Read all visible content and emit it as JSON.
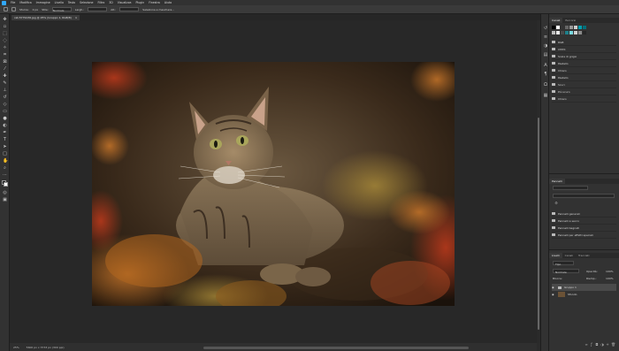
{
  "menubar": {
    "items": [
      "File",
      "Modifica",
      "Immagine",
      "Livello",
      "Testo",
      "Selezione",
      "Filtro",
      "3D",
      "Visualizza",
      "Plugin",
      "Finestra",
      "Aiuto"
    ]
  },
  "optionsbar": {
    "sfumatura_label": "Sfuma:",
    "sfumatura_value": "0 px",
    "stile_label": "Stile:",
    "stile_value": "Normale",
    "larghezza_label": "Largh.:",
    "altezza_label": "Alt.:",
    "seleziona_label": "Seleziona e maschera..."
  },
  "document": {
    "tab_title": "cat-5779136.jpg @ 25% (Gruppo 1, RGB/8)",
    "close_glyph": "×"
  },
  "status": {
    "zoom": "25%",
    "doc_size": "5600 px x 3733 px (300 ppi)"
  },
  "right_panel": {
    "top_tabs": [
      "Canali",
      "Percorsi"
    ],
    "swatch_colors": [
      "#000000",
      "#ffffff",
      "#333333",
      "#666666",
      "#999999",
      "#cccccc",
      "#00a0b0",
      "#006f7a",
      "#bcbcbc",
      "#e7e7e7",
      "#4a4a4a",
      "#1e7f8a",
      "#7ad8df",
      "#cfcfcf",
      "#8b8b8b",
      "#262626"
    ],
    "channel_groups": [
      "RGB",
      "CMYK",
      "Scala di grigio",
      "Pastello",
      "Chiaro",
      "Pastello",
      "Scuri",
      "Più scuro",
      "Chiaro"
    ],
    "middle_title": "Pennelli",
    "brush_groups": [
      "Pennelli generali",
      "Pennelli a secco",
      "Pennelli bagnati",
      "Pennelli per effetti speciali"
    ],
    "layers_tabs": [
      "Livelli",
      "Canali",
      "Tracciati"
    ],
    "layers_kind_label": "Tipo",
    "blend_mode": "Normale",
    "opacity_label": "Opacità:",
    "opacity_value": "100%",
    "lock_label": "Blocca:",
    "fill_label": "Riemp.:",
    "fill_value": "100%",
    "layers": [
      {
        "name": "Gruppo 1"
      },
      {
        "name": "Sfondo"
      }
    ]
  },
  "colors": {
    "photoshop_accent": "#31a8ff",
    "canvas_bg": "#282828",
    "panel_bg": "#323232"
  }
}
